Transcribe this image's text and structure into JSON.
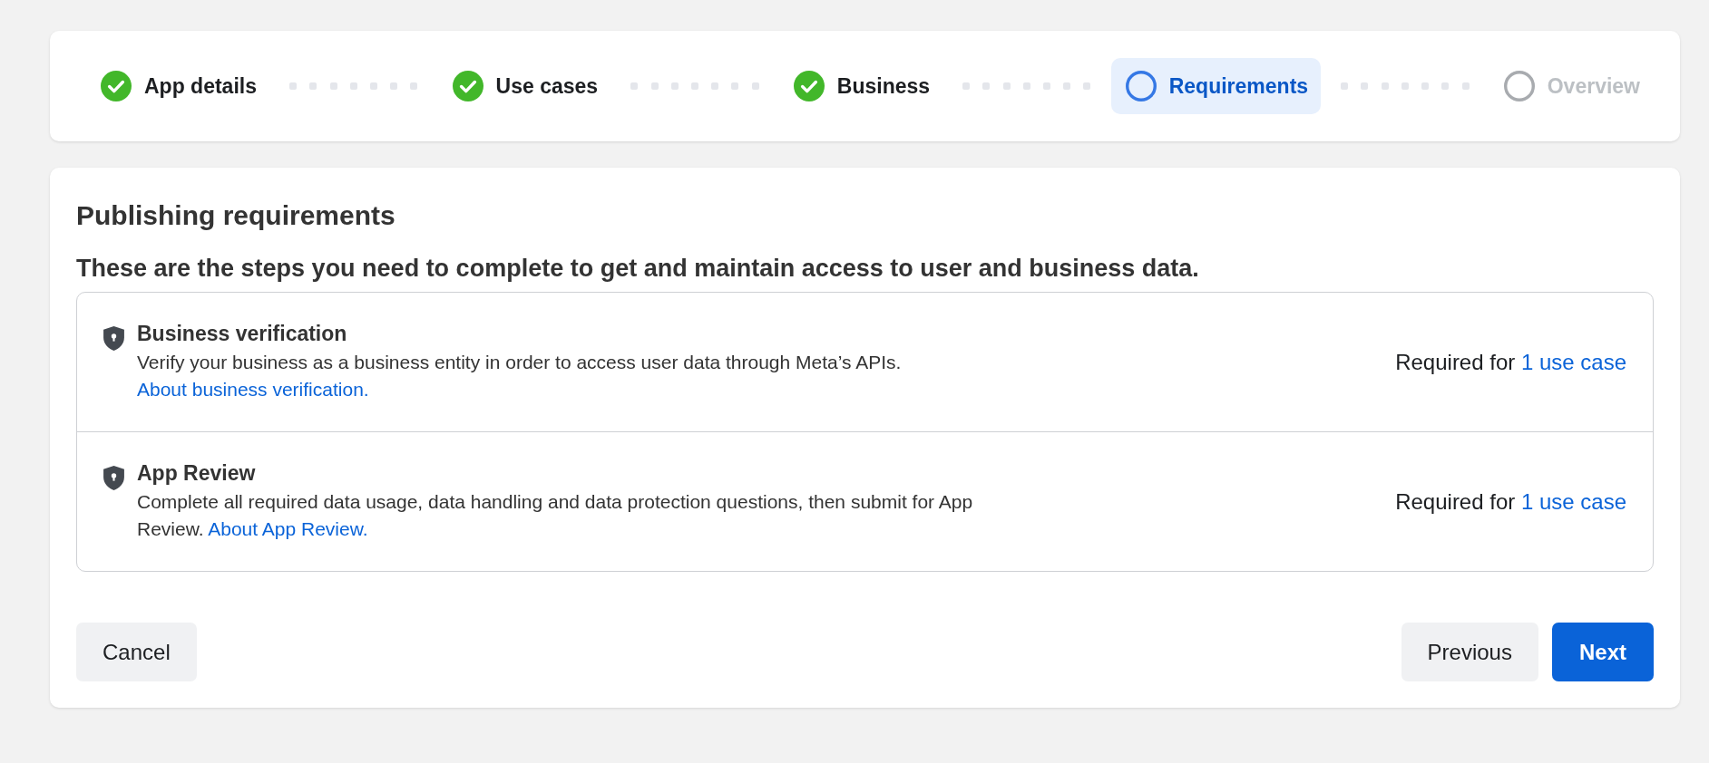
{
  "steps": [
    {
      "label": "App details",
      "kind": "done",
      "selected": false
    },
    {
      "label": "Use cases",
      "kind": "done",
      "selected": false
    },
    {
      "label": "Business",
      "kind": "done",
      "selected": false
    },
    {
      "label": "Requirements",
      "kind": "current",
      "selected": true
    },
    {
      "label": "Overview",
      "kind": "todo",
      "selected": false
    }
  ],
  "title": "Publishing requirements",
  "subtitle": "These are the steps you need to complete to get and maintain access to user and business data.",
  "requirements": [
    {
      "title": "Business verification",
      "description": "Verify your business as a business entity in order to access user data through Meta’s APIs.",
      "link": "About business verification.",
      "required_prefix": "Required for",
      "required_link": "1 use case"
    },
    {
      "title": "App Review",
      "description": "Complete all required data usage, data handling and data protection questions, then submit for App Review.",
      "link": "About App Review.",
      "required_prefix": "Required for",
      "required_link": "1 use case"
    }
  ],
  "buttons": {
    "cancel": "Cancel",
    "previous": "Previous",
    "next": "Next"
  }
}
